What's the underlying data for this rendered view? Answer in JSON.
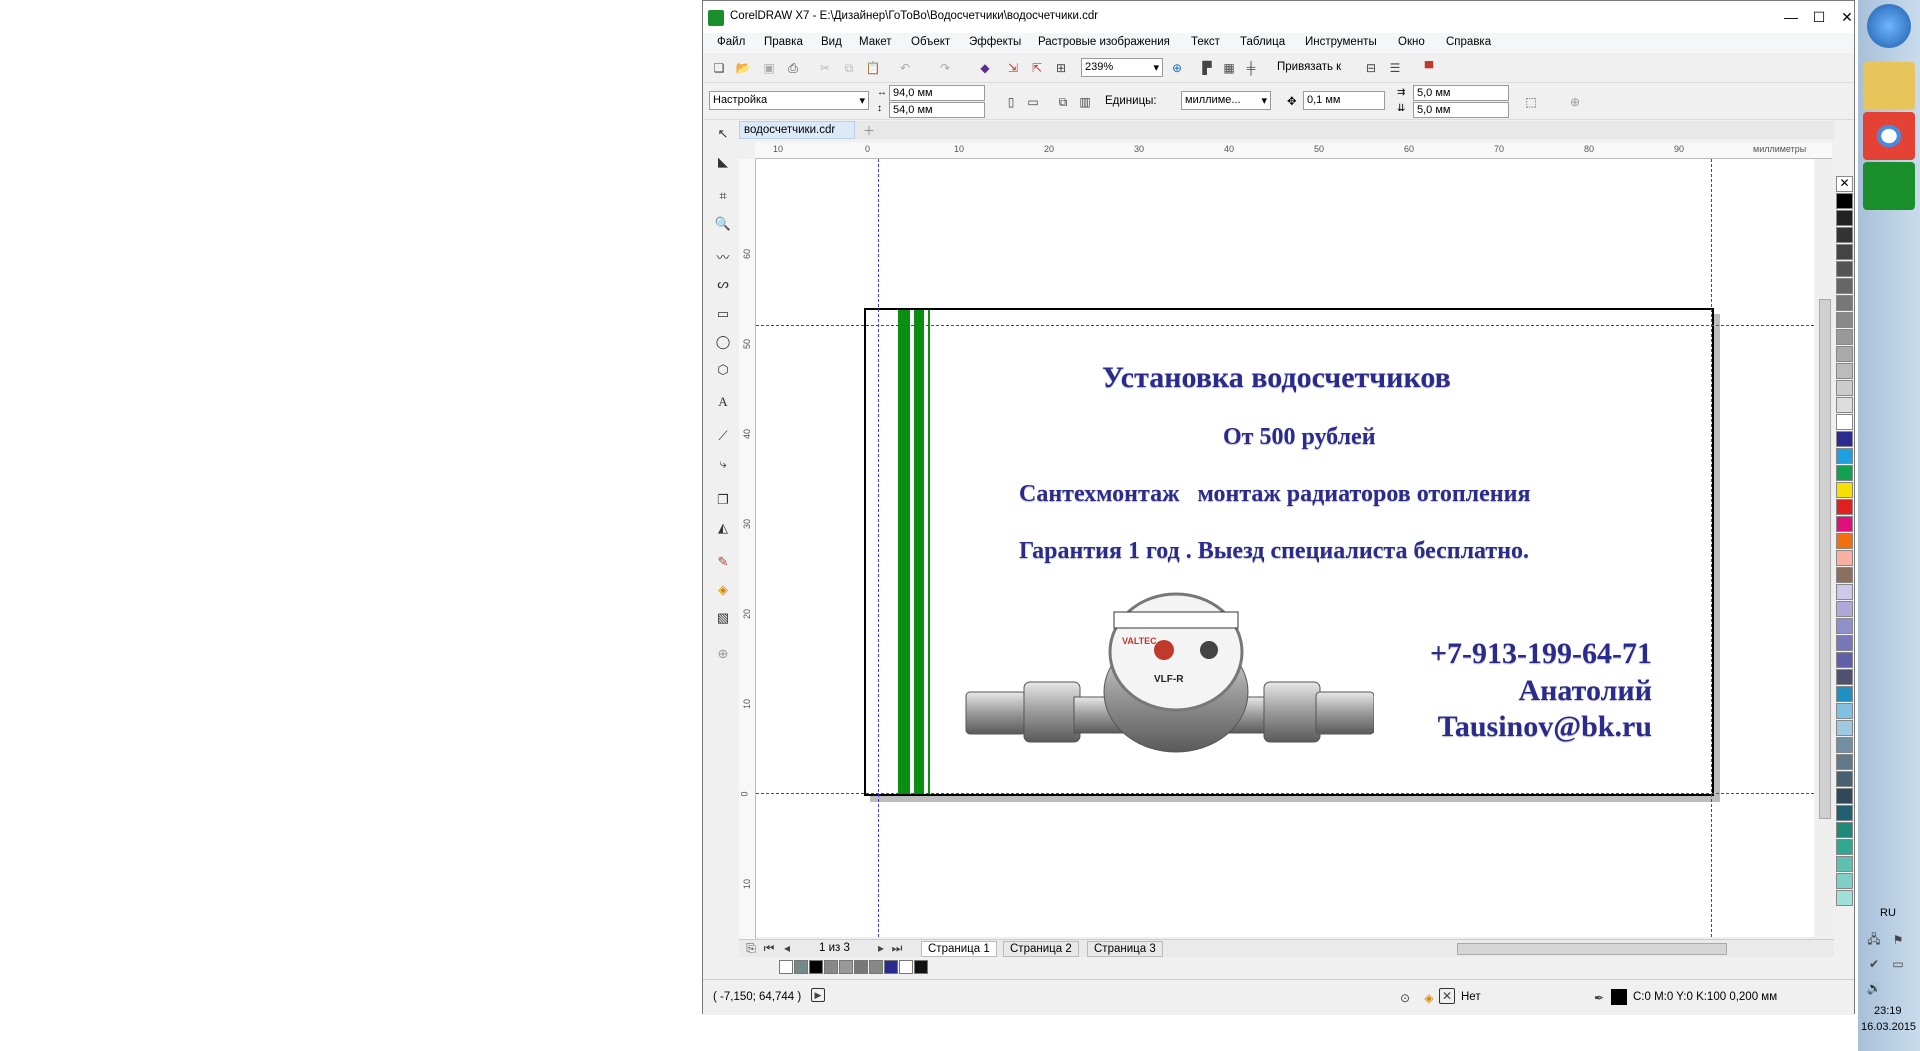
{
  "window": {
    "title": "CorelDRAW X7 - E:\\Дизайнер\\ГоТоВо\\Водосчетчики\\водосчетчики.cdr",
    "controls": {
      "minimize": "—",
      "maximize": "☐",
      "close": "✕"
    }
  },
  "menu": [
    "Файл",
    "Правка",
    "Вид",
    "Макет",
    "Объект",
    "Эффекты",
    "Растровые изображения",
    "Текст",
    "Таблица",
    "Инструменты",
    "Окно",
    "Справка"
  ],
  "standard_toolbar": {
    "zoom": "239%",
    "snap_label": "Привязать к"
  },
  "property_bar": {
    "preset": "Настройка",
    "width": "94,0 мм",
    "height": "54,0 мм",
    "units_label": "Единицы:",
    "units_value": "миллиме...",
    "nudge": "0,1 мм",
    "dup_x": "5,0 мм",
    "dup_y": "5,0 мм"
  },
  "document_tab": "водосчетчики.cdr",
  "ruler": {
    "unit_label": "миллиметры",
    "h_ticks": [
      "10",
      "0",
      "10",
      "20",
      "30",
      "40",
      "50",
      "60",
      "70",
      "80",
      "90"
    ],
    "v_ticks": [
      "60",
      "50",
      "40",
      "30",
      "20",
      "10",
      "0",
      "10"
    ]
  },
  "card": {
    "title": "Установка водосчетчиков",
    "price": "От 500 рублей",
    "services": "Сантехмонтаж   монтаж радиаторов отопления",
    "guarantee": "Гарантия 1 год . Выезд специалиста бесплатно.",
    "phone": "+7-913-199-64-71",
    "name": "Анатолий",
    "email": "Tausinov@bk.ru",
    "meter_brand": "VALTEC",
    "meter_model": "VLF-R",
    "accent_green": "#0a8f12",
    "text_color": "#2b2b8f"
  },
  "pages": {
    "counter": "1 из 3",
    "tabs": [
      "Страница 1",
      "Страница 2",
      "Страница 3"
    ]
  },
  "status": {
    "coords": "( -7,150; 64,744 )",
    "fill_none": "Нет",
    "outline_info": "C:0 M:0 Y:0 K:100  0,200 мм"
  },
  "taskbar": {
    "lang": "RU",
    "time": "23:19",
    "date": "16.03.2015"
  }
}
